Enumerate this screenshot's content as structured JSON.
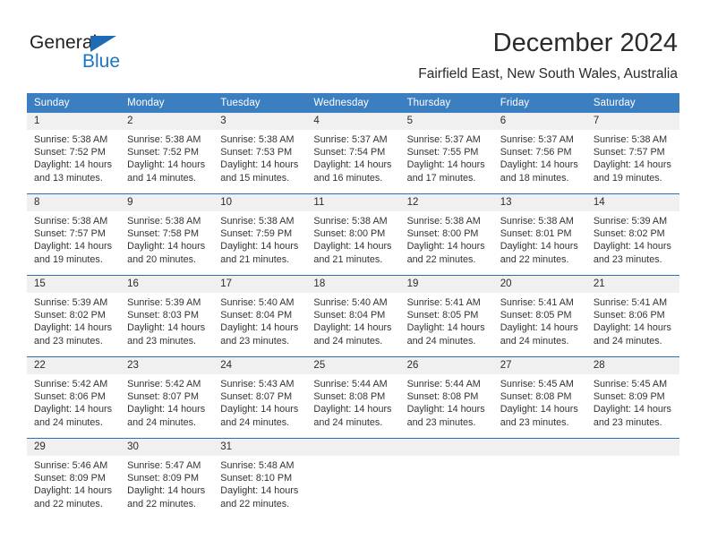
{
  "brand": {
    "name_dark": "General",
    "name_blue": "Blue",
    "accent_color": "#1b76c4",
    "header_color": "#3c7fc1"
  },
  "header": {
    "title": "December 2024",
    "subtitle": "Fairfield East, New South Wales, Australia"
  },
  "calendar": {
    "weekday_headers": [
      "Sunday",
      "Monday",
      "Tuesday",
      "Wednesday",
      "Thursday",
      "Friday",
      "Saturday"
    ],
    "weeks": [
      [
        {
          "day": "1",
          "sunrise": "Sunrise: 5:38 AM",
          "sunset": "Sunset: 7:52 PM",
          "daylight_1": "Daylight: 14 hours",
          "daylight_2": "and 13 minutes."
        },
        {
          "day": "2",
          "sunrise": "Sunrise: 5:38 AM",
          "sunset": "Sunset: 7:52 PM",
          "daylight_1": "Daylight: 14 hours",
          "daylight_2": "and 14 minutes."
        },
        {
          "day": "3",
          "sunrise": "Sunrise: 5:38 AM",
          "sunset": "Sunset: 7:53 PM",
          "daylight_1": "Daylight: 14 hours",
          "daylight_2": "and 15 minutes."
        },
        {
          "day": "4",
          "sunrise": "Sunrise: 5:37 AM",
          "sunset": "Sunset: 7:54 PM",
          "daylight_1": "Daylight: 14 hours",
          "daylight_2": "and 16 minutes."
        },
        {
          "day": "5",
          "sunrise": "Sunrise: 5:37 AM",
          "sunset": "Sunset: 7:55 PM",
          "daylight_1": "Daylight: 14 hours",
          "daylight_2": "and 17 minutes."
        },
        {
          "day": "6",
          "sunrise": "Sunrise: 5:37 AM",
          "sunset": "Sunset: 7:56 PM",
          "daylight_1": "Daylight: 14 hours",
          "daylight_2": "and 18 minutes."
        },
        {
          "day": "7",
          "sunrise": "Sunrise: 5:38 AM",
          "sunset": "Sunset: 7:57 PM",
          "daylight_1": "Daylight: 14 hours",
          "daylight_2": "and 19 minutes."
        }
      ],
      [
        {
          "day": "8",
          "sunrise": "Sunrise: 5:38 AM",
          "sunset": "Sunset: 7:57 PM",
          "daylight_1": "Daylight: 14 hours",
          "daylight_2": "and 19 minutes."
        },
        {
          "day": "9",
          "sunrise": "Sunrise: 5:38 AM",
          "sunset": "Sunset: 7:58 PM",
          "daylight_1": "Daylight: 14 hours",
          "daylight_2": "and 20 minutes."
        },
        {
          "day": "10",
          "sunrise": "Sunrise: 5:38 AM",
          "sunset": "Sunset: 7:59 PM",
          "daylight_1": "Daylight: 14 hours",
          "daylight_2": "and 21 minutes."
        },
        {
          "day": "11",
          "sunrise": "Sunrise: 5:38 AM",
          "sunset": "Sunset: 8:00 PM",
          "daylight_1": "Daylight: 14 hours",
          "daylight_2": "and 21 minutes."
        },
        {
          "day": "12",
          "sunrise": "Sunrise: 5:38 AM",
          "sunset": "Sunset: 8:00 PM",
          "daylight_1": "Daylight: 14 hours",
          "daylight_2": "and 22 minutes."
        },
        {
          "day": "13",
          "sunrise": "Sunrise: 5:38 AM",
          "sunset": "Sunset: 8:01 PM",
          "daylight_1": "Daylight: 14 hours",
          "daylight_2": "and 22 minutes."
        },
        {
          "day": "14",
          "sunrise": "Sunrise: 5:39 AM",
          "sunset": "Sunset: 8:02 PM",
          "daylight_1": "Daylight: 14 hours",
          "daylight_2": "and 23 minutes."
        }
      ],
      [
        {
          "day": "15",
          "sunrise": "Sunrise: 5:39 AM",
          "sunset": "Sunset: 8:02 PM",
          "daylight_1": "Daylight: 14 hours",
          "daylight_2": "and 23 minutes."
        },
        {
          "day": "16",
          "sunrise": "Sunrise: 5:39 AM",
          "sunset": "Sunset: 8:03 PM",
          "daylight_1": "Daylight: 14 hours",
          "daylight_2": "and 23 minutes."
        },
        {
          "day": "17",
          "sunrise": "Sunrise: 5:40 AM",
          "sunset": "Sunset: 8:04 PM",
          "daylight_1": "Daylight: 14 hours",
          "daylight_2": "and 23 minutes."
        },
        {
          "day": "18",
          "sunrise": "Sunrise: 5:40 AM",
          "sunset": "Sunset: 8:04 PM",
          "daylight_1": "Daylight: 14 hours",
          "daylight_2": "and 24 minutes."
        },
        {
          "day": "19",
          "sunrise": "Sunrise: 5:41 AM",
          "sunset": "Sunset: 8:05 PM",
          "daylight_1": "Daylight: 14 hours",
          "daylight_2": "and 24 minutes."
        },
        {
          "day": "20",
          "sunrise": "Sunrise: 5:41 AM",
          "sunset": "Sunset: 8:05 PM",
          "daylight_1": "Daylight: 14 hours",
          "daylight_2": "and 24 minutes."
        },
        {
          "day": "21",
          "sunrise": "Sunrise: 5:41 AM",
          "sunset": "Sunset: 8:06 PM",
          "daylight_1": "Daylight: 14 hours",
          "daylight_2": "and 24 minutes."
        }
      ],
      [
        {
          "day": "22",
          "sunrise": "Sunrise: 5:42 AM",
          "sunset": "Sunset: 8:06 PM",
          "daylight_1": "Daylight: 14 hours",
          "daylight_2": "and 24 minutes."
        },
        {
          "day": "23",
          "sunrise": "Sunrise: 5:42 AM",
          "sunset": "Sunset: 8:07 PM",
          "daylight_1": "Daylight: 14 hours",
          "daylight_2": "and 24 minutes."
        },
        {
          "day": "24",
          "sunrise": "Sunrise: 5:43 AM",
          "sunset": "Sunset: 8:07 PM",
          "daylight_1": "Daylight: 14 hours",
          "daylight_2": "and 24 minutes."
        },
        {
          "day": "25",
          "sunrise": "Sunrise: 5:44 AM",
          "sunset": "Sunset: 8:08 PM",
          "daylight_1": "Daylight: 14 hours",
          "daylight_2": "and 24 minutes."
        },
        {
          "day": "26",
          "sunrise": "Sunrise: 5:44 AM",
          "sunset": "Sunset: 8:08 PM",
          "daylight_1": "Daylight: 14 hours",
          "daylight_2": "and 23 minutes."
        },
        {
          "day": "27",
          "sunrise": "Sunrise: 5:45 AM",
          "sunset": "Sunset: 8:08 PM",
          "daylight_1": "Daylight: 14 hours",
          "daylight_2": "and 23 minutes."
        },
        {
          "day": "28",
          "sunrise": "Sunrise: 5:45 AM",
          "sunset": "Sunset: 8:09 PM",
          "daylight_1": "Daylight: 14 hours",
          "daylight_2": "and 23 minutes."
        }
      ],
      [
        {
          "day": "29",
          "sunrise": "Sunrise: 5:46 AM",
          "sunset": "Sunset: 8:09 PM",
          "daylight_1": "Daylight: 14 hours",
          "daylight_2": "and 22 minutes."
        },
        {
          "day": "30",
          "sunrise": "Sunrise: 5:47 AM",
          "sunset": "Sunset: 8:09 PM",
          "daylight_1": "Daylight: 14 hours",
          "daylight_2": "and 22 minutes."
        },
        {
          "day": "31",
          "sunrise": "Sunrise: 5:48 AM",
          "sunset": "Sunset: 8:10 PM",
          "daylight_1": "Daylight: 14 hours",
          "daylight_2": "and 22 minutes."
        },
        {
          "day": "",
          "sunrise": "",
          "sunset": "",
          "daylight_1": "",
          "daylight_2": ""
        },
        {
          "day": "",
          "sunrise": "",
          "sunset": "",
          "daylight_1": "",
          "daylight_2": ""
        },
        {
          "day": "",
          "sunrise": "",
          "sunset": "",
          "daylight_1": "",
          "daylight_2": ""
        },
        {
          "day": "",
          "sunrise": "",
          "sunset": "",
          "daylight_1": "",
          "daylight_2": ""
        }
      ]
    ]
  }
}
